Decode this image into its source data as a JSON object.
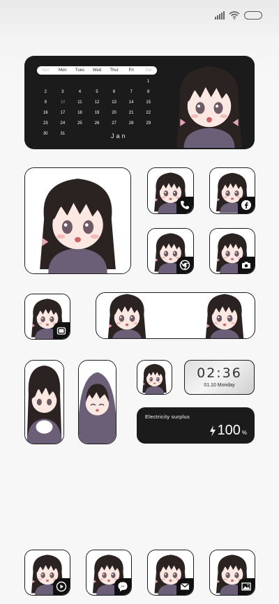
{
  "calendar": {
    "weekdays": [
      "Sun",
      "Mon",
      "Tues",
      "Wed",
      "Thur",
      "Fri",
      "Sat"
    ],
    "days": [
      "",
      "",
      "",
      "",
      "",
      "",
      "1",
      "2",
      "3",
      "4",
      "5",
      "6",
      "7",
      "8",
      "9",
      "10",
      "11",
      "12",
      "13",
      "14",
      "15",
      "16",
      "17",
      "18",
      "19",
      "20",
      "21",
      "22",
      "23",
      "24",
      "25",
      "26",
      "27",
      "28",
      "29",
      "30",
      "31",
      "",
      "",
      "",
      "",
      ""
    ],
    "month": "Jan"
  },
  "clock": {
    "time": "02:36",
    "date": "01.10 Monday"
  },
  "electricity": {
    "label": "Electricity surplus",
    "value": "100",
    "unit": "%"
  },
  "colors": {
    "dark": "#1b1b1b",
    "hair": "#2b2321",
    "skin": "#fbe8e2",
    "shirt": "#6b5f78",
    "eye": "#6d5a64"
  }
}
